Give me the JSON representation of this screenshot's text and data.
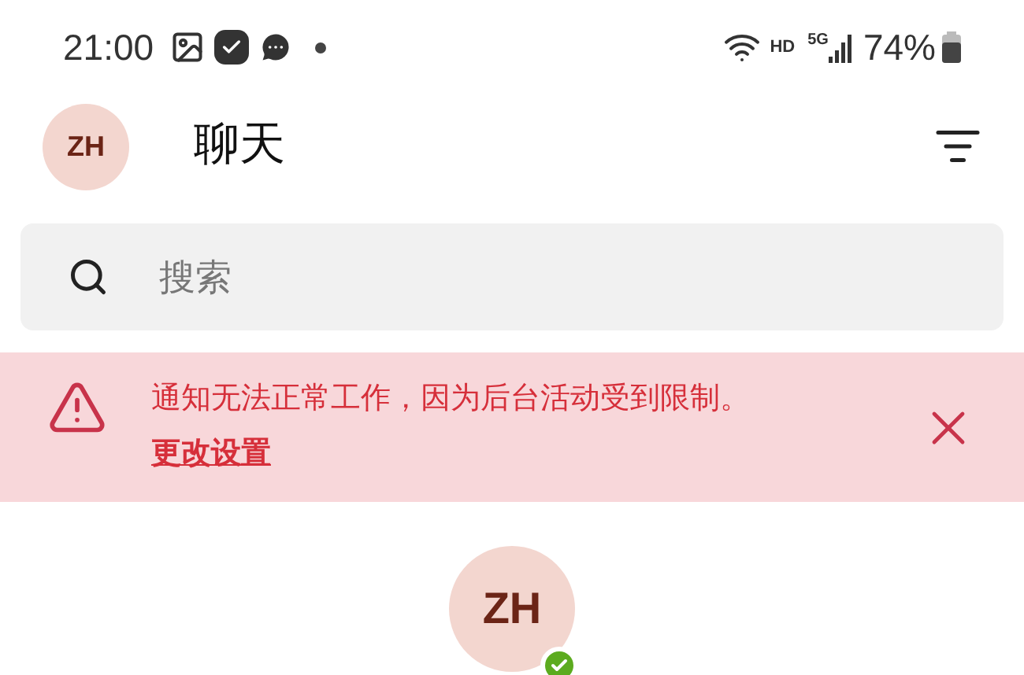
{
  "status_bar": {
    "time": "21:00",
    "hd": "HD",
    "network": "5G",
    "battery": "74%"
  },
  "header": {
    "avatar": "ZH",
    "title": "聊天"
  },
  "search": {
    "placeholder": "搜索"
  },
  "banner": {
    "message": "通知无法正常工作，因为后台活动受到限制。",
    "link": "更改设置"
  },
  "profile": {
    "avatar": "ZH",
    "online": true
  }
}
